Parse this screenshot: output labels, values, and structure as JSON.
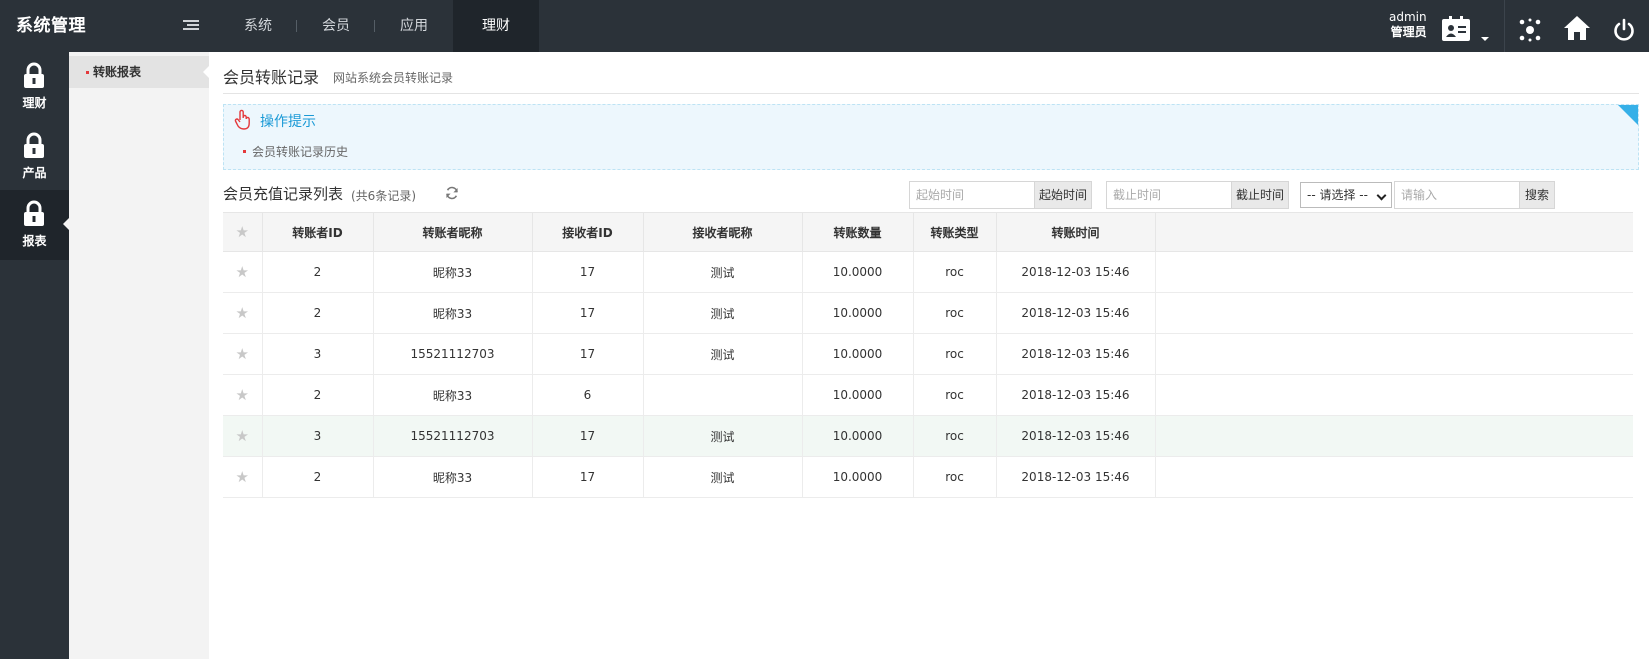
{
  "brand": "系统管理",
  "nav": {
    "tabs": [
      "系统",
      "会员",
      "应用",
      "理财"
    ],
    "active_index": 3
  },
  "user": {
    "name": "admin",
    "role": "管理员"
  },
  "sidebar": {
    "items": [
      {
        "label": "理财"
      },
      {
        "label": "产品"
      },
      {
        "label": "报表"
      }
    ]
  },
  "subnav": {
    "item": "转账报表"
  },
  "page": {
    "title": "会员转账记录",
    "subtitle": "网站系统会员转账记录"
  },
  "tips": {
    "title": "操作提示",
    "line": "会员转账记录历史"
  },
  "list": {
    "title": "会员充值记录列表",
    "count": "(共6条记录)"
  },
  "search": {
    "start_placeholder": "起始时间",
    "start_btn": "起始时间",
    "end_placeholder": "截止时间",
    "end_btn": "截止时间",
    "select_value": "-- 请选择 --",
    "keyword_placeholder": "请输入",
    "search_btn": "搜索"
  },
  "table": {
    "columns": [
      "转账者ID",
      "转账者昵称",
      "接收者ID",
      "接收者昵称",
      "转账数量",
      "转账类型",
      "转账时间"
    ],
    "rows": [
      [
        "2",
        "昵称33",
        "17",
        "测试",
        "10.0000",
        "roc",
        "2018-12-03 15:46"
      ],
      [
        "2",
        "昵称33",
        "17",
        "测试",
        "10.0000",
        "roc",
        "2018-12-03 15:46"
      ],
      [
        "3",
        "15521112703",
        "17",
        "测试",
        "10.0000",
        "roc",
        "2018-12-03 15:46"
      ],
      [
        "2",
        "昵称33",
        "6",
        "",
        "10.0000",
        "roc",
        "2018-12-03 15:46"
      ],
      [
        "3",
        "15521112703",
        "17",
        "测试",
        "10.0000",
        "roc",
        "2018-12-03 15:46"
      ],
      [
        "2",
        "昵称33",
        "17",
        "测试",
        "10.0000",
        "roc",
        "2018-12-03 15:46"
      ]
    ],
    "highlight_row": 4
  },
  "colors": {
    "topbar": "#2b3239",
    "accent_blue": "#1b9ad6",
    "tips_bg": "#edf7fd",
    "bullet_red": "#e4393c"
  }
}
